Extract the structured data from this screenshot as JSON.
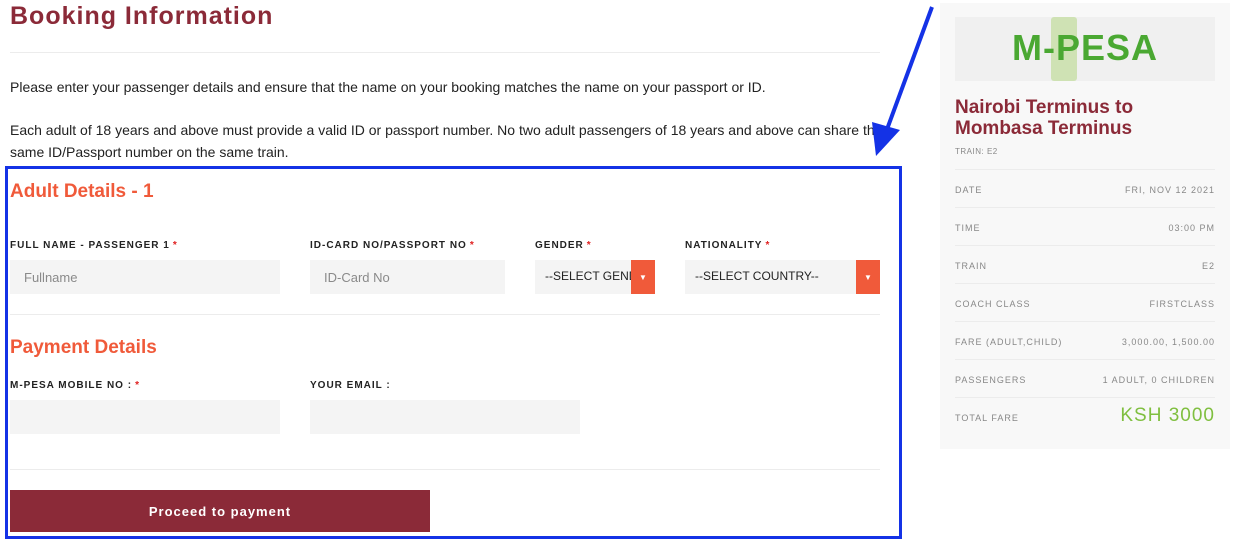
{
  "page": {
    "title": "Booking Information",
    "intro1": "Please enter your passenger details and ensure that the name on your booking matches the name on your passport or ID.",
    "intro2": "Each adult of 18 years and above must provide a valid ID or passport number. No two adult passengers of 18 years and above can share the same ID/Passport number on the same train."
  },
  "adult": {
    "section_title": "Adult Details - 1",
    "fullname_label": "FULL NAME - PASSENGER 1",
    "fullname_placeholder": "Fullname",
    "id_label": "ID-CARD NO/PASSPORT NO",
    "id_placeholder": "ID-Card No",
    "gender_label": "GENDER",
    "gender_value": "--SELECT GENDER--",
    "nationality_label": "NATIONALITY",
    "nationality_value": "--SELECT COUNTRY--",
    "required_mark": "*"
  },
  "payment": {
    "section_title": "Payment Details",
    "mobile_label": "M-PESA MOBILE NO :",
    "email_label": "YOUR EMAIL :",
    "required_mark": "*",
    "proceed_label": "Proceed to payment"
  },
  "sidebar": {
    "logo_text": "M-PESA",
    "route": "Nairobi Terminus to Mombasa Terminus",
    "train_sub": "TRAIN: E2",
    "rows": [
      {
        "label": "DATE",
        "value": "FRI, NOV 12 2021"
      },
      {
        "label": "TIME",
        "value": "03:00 PM"
      },
      {
        "label": "TRAIN",
        "value": "E2"
      },
      {
        "label": "COACH CLASS",
        "value": "FIRSTCLASS"
      },
      {
        "label": "FARE (ADULT,CHILD)",
        "value": "3,000.00, 1,500.00"
      },
      {
        "label": "PASSENGERS",
        "value": "1 ADULT, 0 CHILDREN"
      }
    ],
    "total_label": "TOTAL FARE",
    "total_value": "KSH 3000"
  },
  "colors": {
    "brand": "#8b2a38",
    "accent": "#f05a3a",
    "highlight": "#1432e6",
    "total": "#7fbf3f"
  }
}
